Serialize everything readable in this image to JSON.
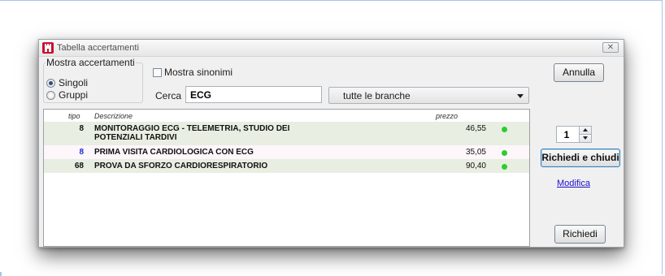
{
  "window": {
    "title": "Tabella accertamenti",
    "close_glyph": "✕"
  },
  "filters": {
    "group_label": "Mostra accertamenti",
    "radio_singoli": "Singoli",
    "radio_gruppi": "Gruppi",
    "selected": "Singoli",
    "synonyms_label": "Mostra sinonimi",
    "synonyms_checked": false,
    "search_label": "Cerca",
    "search_value": "ECG",
    "branch_select": "tutte le branche"
  },
  "table": {
    "headers": {
      "tipo": "tipo",
      "descrizione": "Descrizione",
      "prezzo": "prezzo"
    },
    "rows": [
      {
        "tipo": "8",
        "descrizione": "MONITORAGGIO ECG - TELEMETRIA, STUDIO DEI POTENZIALI TARDIVI",
        "prezzo": "46,55",
        "status_color": "#2ecc2e",
        "tipo_color": "#111111"
      },
      {
        "tipo": "8",
        "descrizione": "PRIMA VISITA CARDIOLOGICA CON ECG",
        "prezzo": "35,05",
        "status_color": "#2ecc2e",
        "tipo_color": "#1a2fd0"
      },
      {
        "tipo": "68",
        "descrizione": "PROVA DA SFORZO CARDIORESPIRATORIO",
        "prezzo": "90,40",
        "status_color": "#2ecc2e",
        "tipo_color": "#111111"
      }
    ]
  },
  "actions": {
    "annulla": "Annulla",
    "quantity": "1",
    "richiedi_chiudi": "Richiedi e chiudi",
    "modifica": "Modifica",
    "richiedi": "Richiedi"
  },
  "icons": {
    "app": "castle-tower-icon",
    "close": "close-icon",
    "dropdown": "chevron-down-icon",
    "status": "status-dot-icon"
  }
}
